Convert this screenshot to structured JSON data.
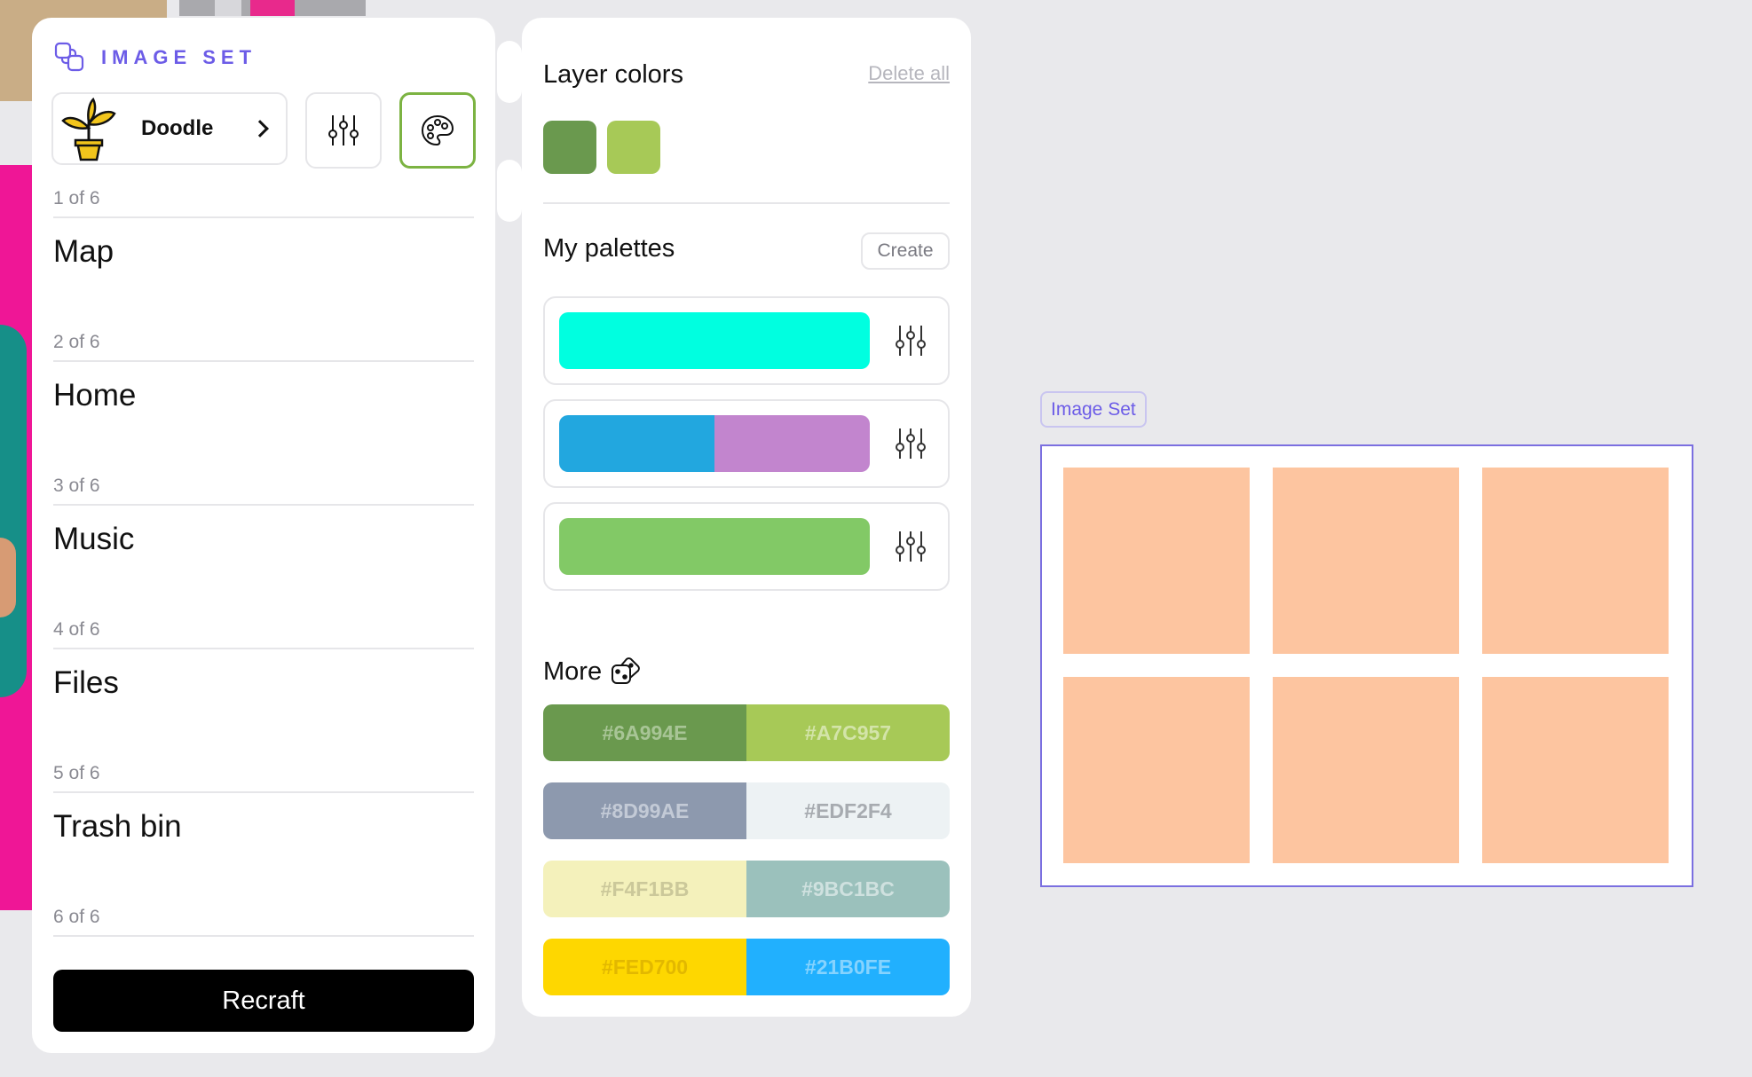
{
  "image_set_panel": {
    "title": "IMAGE SET",
    "style": {
      "name": "Doodle"
    },
    "sections": [
      {
        "count": "1 of 6",
        "value": "Map"
      },
      {
        "count": "2 of 6",
        "value": "Home"
      },
      {
        "count": "3 of 6",
        "value": "Music"
      },
      {
        "count": "4 of 6",
        "value": "Files"
      },
      {
        "count": "5 of 6",
        "value": "Trash bin"
      },
      {
        "count": "6 of 6",
        "value": ""
      }
    ],
    "recraft_label": "Recraft"
  },
  "colors_panel": {
    "layer_colors_title": "Layer colors",
    "delete_all_label": "Delete all",
    "layer_colors": [
      "#6A994E",
      "#A7C957"
    ],
    "my_palettes_title": "My palettes",
    "create_label": "Create",
    "palettes": [
      [
        "#00FFE0"
      ],
      [
        "#22A7DF",
        "#C285CE"
      ],
      [
        "#82C966"
      ]
    ],
    "more_title": "More",
    "more_pairs": [
      {
        "left": {
          "hex": "#6A994E",
          "text_color": "#a8c596"
        },
        "right": {
          "hex": "#A7C957",
          "text_color": "#d3e4a9"
        }
      },
      {
        "left": {
          "hex": "#8D99AE",
          "text_color": "#c3cad6"
        },
        "right": {
          "hex": "#EDF2F4",
          "text_color": "#a7abb0"
        }
      },
      {
        "left": {
          "hex": "#F4F1BB",
          "text_color": "#cbc89a"
        },
        "right": {
          "hex": "#9BC1BC",
          "text_color": "#cfe1df"
        }
      },
      {
        "left": {
          "hex": "#FED700",
          "text_color": "#e2b800"
        },
        "right": {
          "hex": "#21B0FE",
          "text_color": "#86d3fe"
        }
      }
    ]
  },
  "canvas": {
    "frame_label": "Image Set",
    "tile_color": "#FDC5A0",
    "tile_count": 6
  },
  "colors": {
    "accent": "#6C5CE7",
    "active_border": "#7CB342",
    "primary_button": "#000000"
  }
}
